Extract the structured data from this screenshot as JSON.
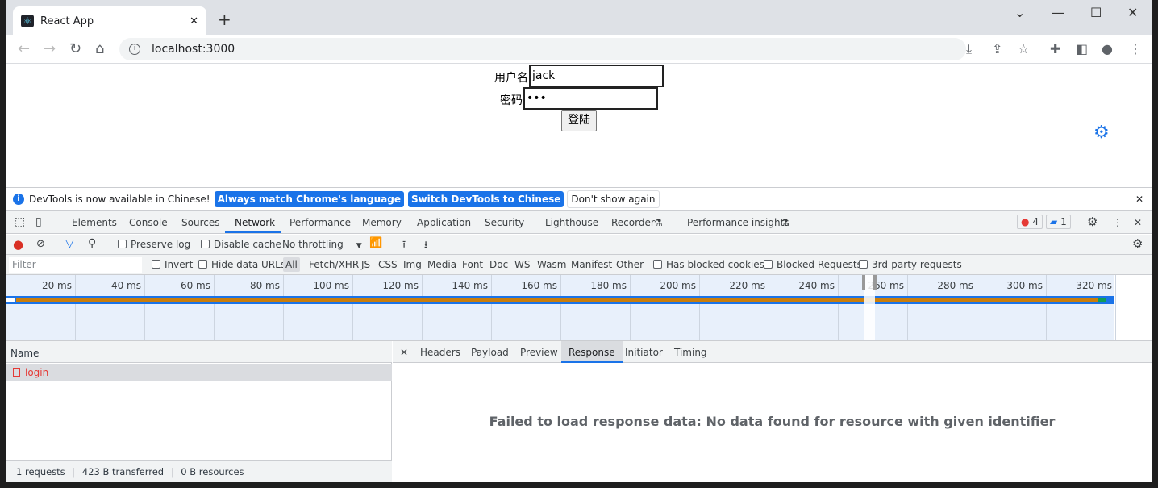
{
  "browser": {
    "tab_title": "React App",
    "url": "localhost:3000"
  },
  "page": {
    "username_label": "用户名",
    "username_value": "jack",
    "password_label": "密码",
    "password_value": "•••",
    "login_button": "登陆"
  },
  "infobar": {
    "message": "DevTools is now available in Chinese!",
    "btn_match": "Always match Chrome's language",
    "btn_switch": "Switch DevTools to Chinese",
    "btn_dismiss": "Don't show again"
  },
  "devtools": {
    "tabs": [
      "Elements",
      "Console",
      "Sources",
      "Network",
      "Performance",
      "Memory",
      "Application",
      "Security",
      "Lighthouse",
      "Recorder",
      "Performance insights"
    ],
    "active_tab": "Network",
    "error_count": "4",
    "message_count": "1",
    "toolbar": {
      "preserve_log": "Preserve log",
      "disable_cache": "Disable cache",
      "throttling": "No throttling"
    },
    "filter": {
      "placeholder": "Filter",
      "invert": "Invert",
      "hide_data_urls": "Hide data URLs",
      "types": [
        "All",
        "Fetch/XHR",
        "JS",
        "CSS",
        "Img",
        "Media",
        "Font",
        "Doc",
        "WS",
        "Wasm",
        "Manifest",
        "Other"
      ],
      "has_blocked_cookies": "Has blocked cookies",
      "blocked_requests": "Blocked Requests",
      "third_party": "3rd-party requests"
    },
    "timeline_ticks": [
      "20 ms",
      "40 ms",
      "60 ms",
      "80 ms",
      "100 ms",
      "120 ms",
      "140 ms",
      "160 ms",
      "180 ms",
      "200 ms",
      "220 ms",
      "240 ms",
      "260 ms",
      "280 ms",
      "300 ms",
      "320 ms"
    ],
    "requests": {
      "header": "Name",
      "rows": [
        {
          "name": "login",
          "status": "failed"
        }
      ]
    },
    "footer": {
      "requests": "1 requests",
      "transferred": "423 B transferred",
      "resources": "0 B resources"
    },
    "detail_tabs": [
      "Headers",
      "Payload",
      "Preview",
      "Response",
      "Initiator",
      "Timing"
    ],
    "active_detail_tab": "Response",
    "response_message": "Failed to load response data: No data found for resource with given identifier"
  },
  "colors": {
    "accent": "#1a73e8",
    "error": "#e53935",
    "bar": "#c97d0c"
  }
}
